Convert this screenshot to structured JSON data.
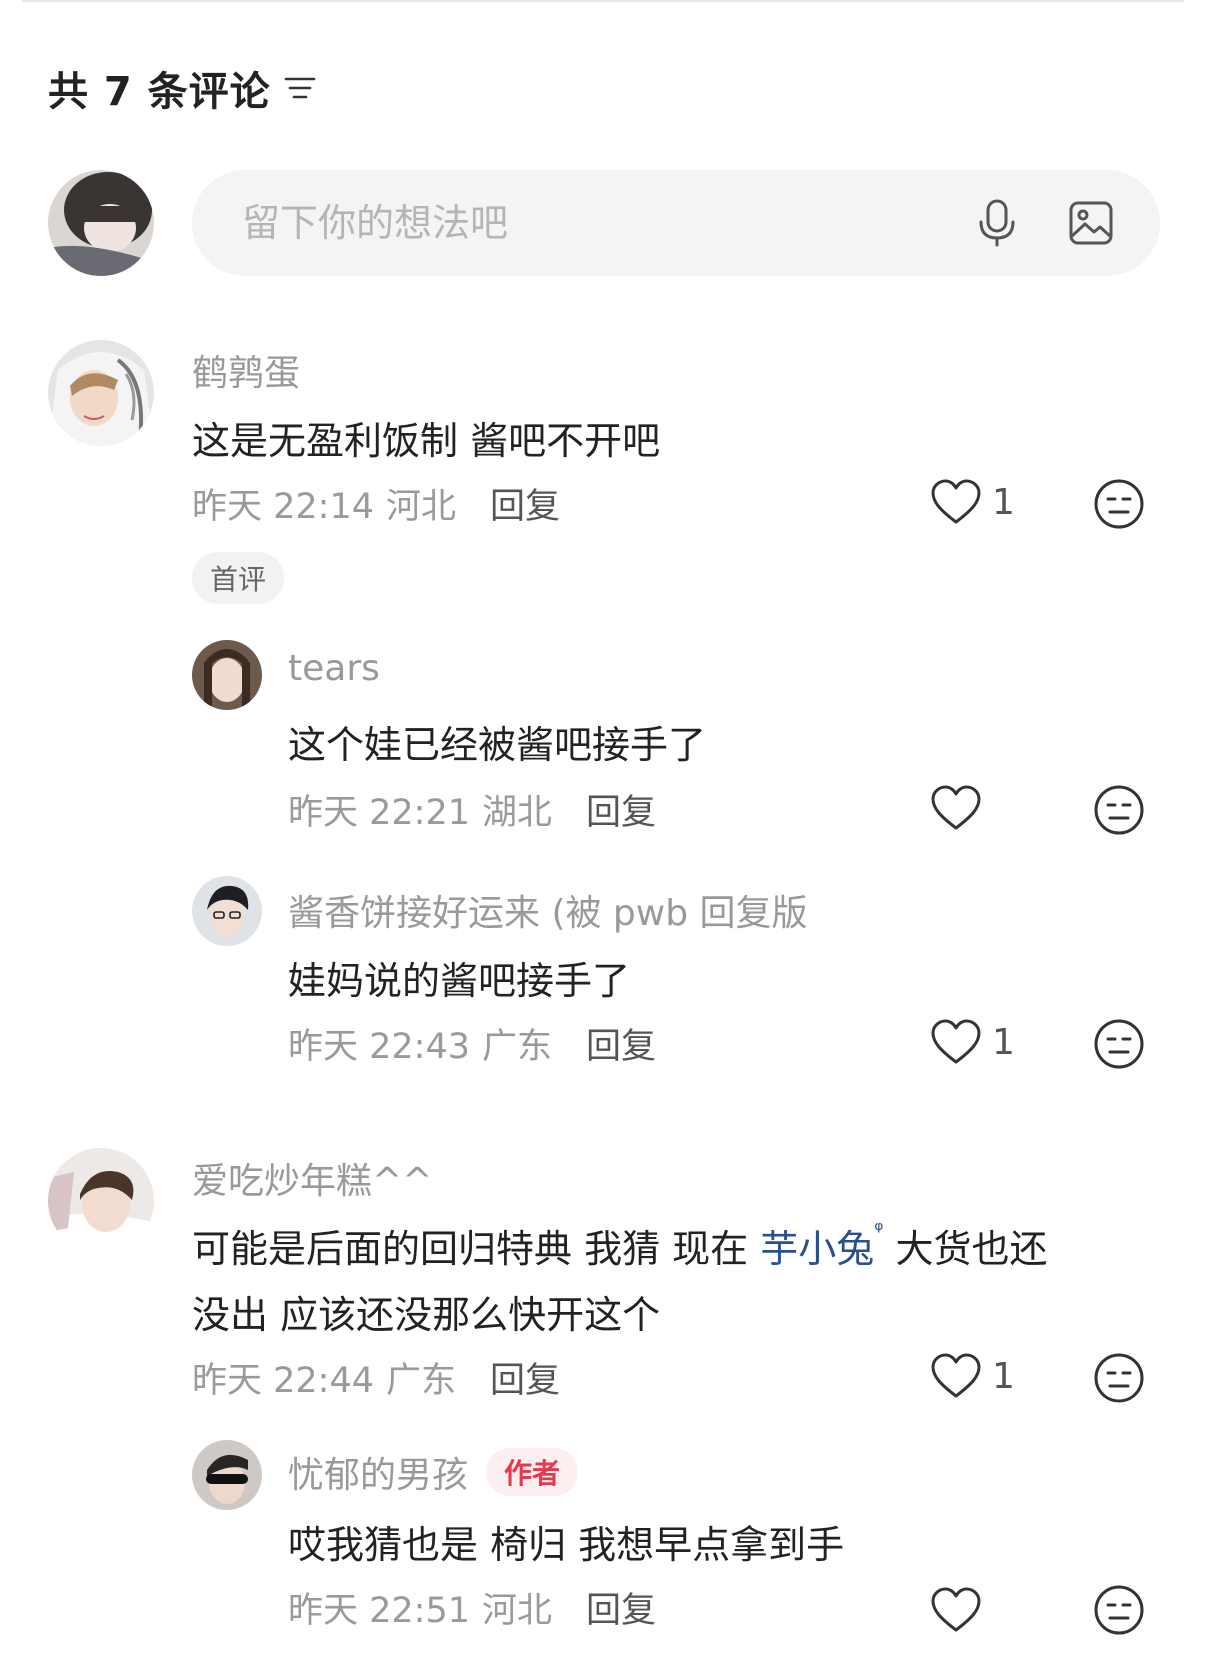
{
  "header": {
    "title": "共 7 条评论",
    "filter_icon": "filter-lines-icon"
  },
  "composer": {
    "placeholder": "留下你的想法吧",
    "voice_icon": "microphone-icon",
    "image_icon": "image-icon"
  },
  "comments": [
    {
      "user": "鹤鹑蛋",
      "text": "这是无盈利饭制 酱吧不开吧",
      "time": "昨天 22:14",
      "location": "河北",
      "reply": "回复",
      "likes": "1",
      "badge": "首评",
      "replies": [
        {
          "user": "tears",
          "text": "这个娃已经被酱吧接手了",
          "time": "昨天 22:21",
          "location": "湖北",
          "reply": "回复",
          "likes": ""
        },
        {
          "user": "酱香饼接好运来 (被 pwb 回复版",
          "text": "娃妈说的酱吧接手了",
          "time": "昨天 22:43",
          "location": "广东",
          "reply": "回复",
          "likes": "1"
        }
      ]
    },
    {
      "user": "爱吃炒年糕^^",
      "text_before": "可能是后面的回归特典 我猜 现在 ",
      "mention": "芋小兔",
      "mention_mark": "ᵠ",
      "text_after": " 大货也还",
      "text_line2": "没出 应该还没那么快开这个",
      "time": "昨天 22:44",
      "location": "广东",
      "reply": "回复",
      "likes": "1",
      "replies": [
        {
          "user": "忧郁的男孩",
          "author_badge": "作者",
          "text": "哎我猜也是 椅归 我想早点拿到手",
          "time": "昨天 22:51",
          "location": "河北",
          "reply": "回复",
          "likes": ""
        }
      ]
    }
  ]
}
